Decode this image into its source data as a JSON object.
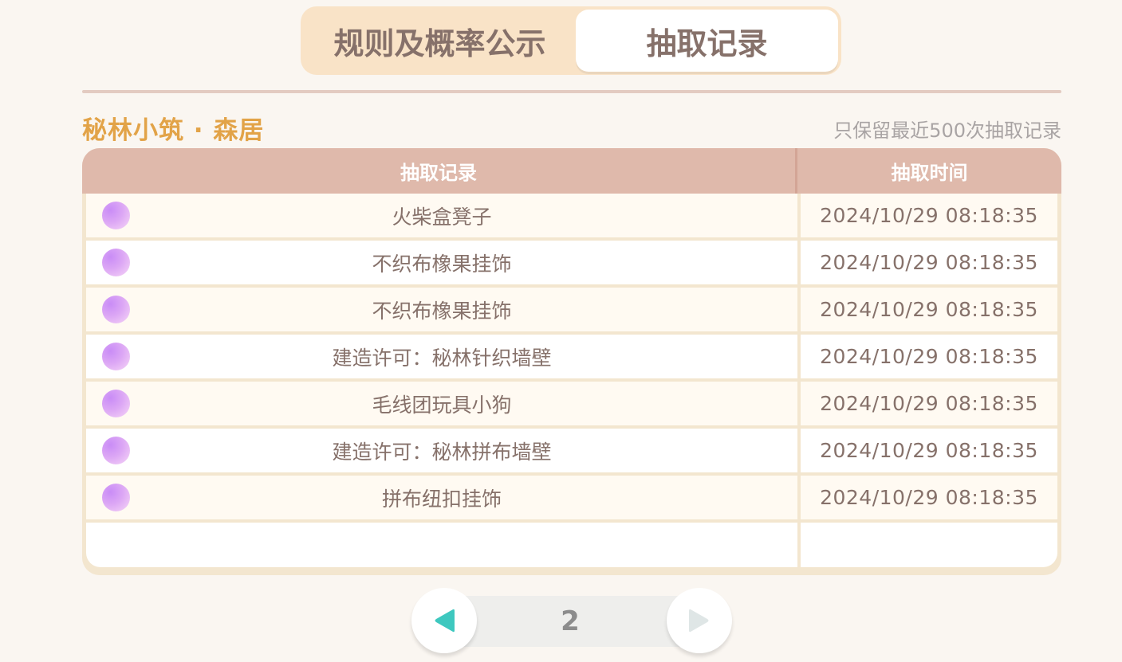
{
  "tabs": {
    "rules_label": "规则及概率公示",
    "records_label": "抽取记录"
  },
  "pool": {
    "title": "秘林小筑 · 森居",
    "note": "只保留最近500次抽取记录"
  },
  "table": {
    "col_item": "抽取记录",
    "col_time": "抽取时间",
    "rows": [
      {
        "name": "火柴盒凳子",
        "time": "2024/10/29 08:18:35"
      },
      {
        "name": "不织布橡果挂饰",
        "time": "2024/10/29 08:18:35"
      },
      {
        "name": "不织布橡果挂饰",
        "time": "2024/10/29 08:18:35"
      },
      {
        "name": "建造许可：秘林针织墙壁",
        "time": "2024/10/29 08:18:35"
      },
      {
        "name": "毛线团玩具小狗",
        "time": "2024/10/29 08:18:35"
      },
      {
        "name": "建造许可：秘林拼布墙壁",
        "time": "2024/10/29 08:18:35"
      },
      {
        "name": "拼布纽扣挂饰",
        "time": "2024/10/29 08:18:35"
      }
    ]
  },
  "pager": {
    "page": "2"
  },
  "colors": {
    "accent_title": "#e2a348",
    "header_bg": "#dfb9ab",
    "rarity_orb": "#d29df5",
    "prev_arrow": "#3ec8bf",
    "next_arrow": "#dfe6e6"
  },
  "icons": {
    "rarity": "purple-orb-icon",
    "prev": "triangle-left-icon",
    "next": "triangle-right-icon"
  }
}
